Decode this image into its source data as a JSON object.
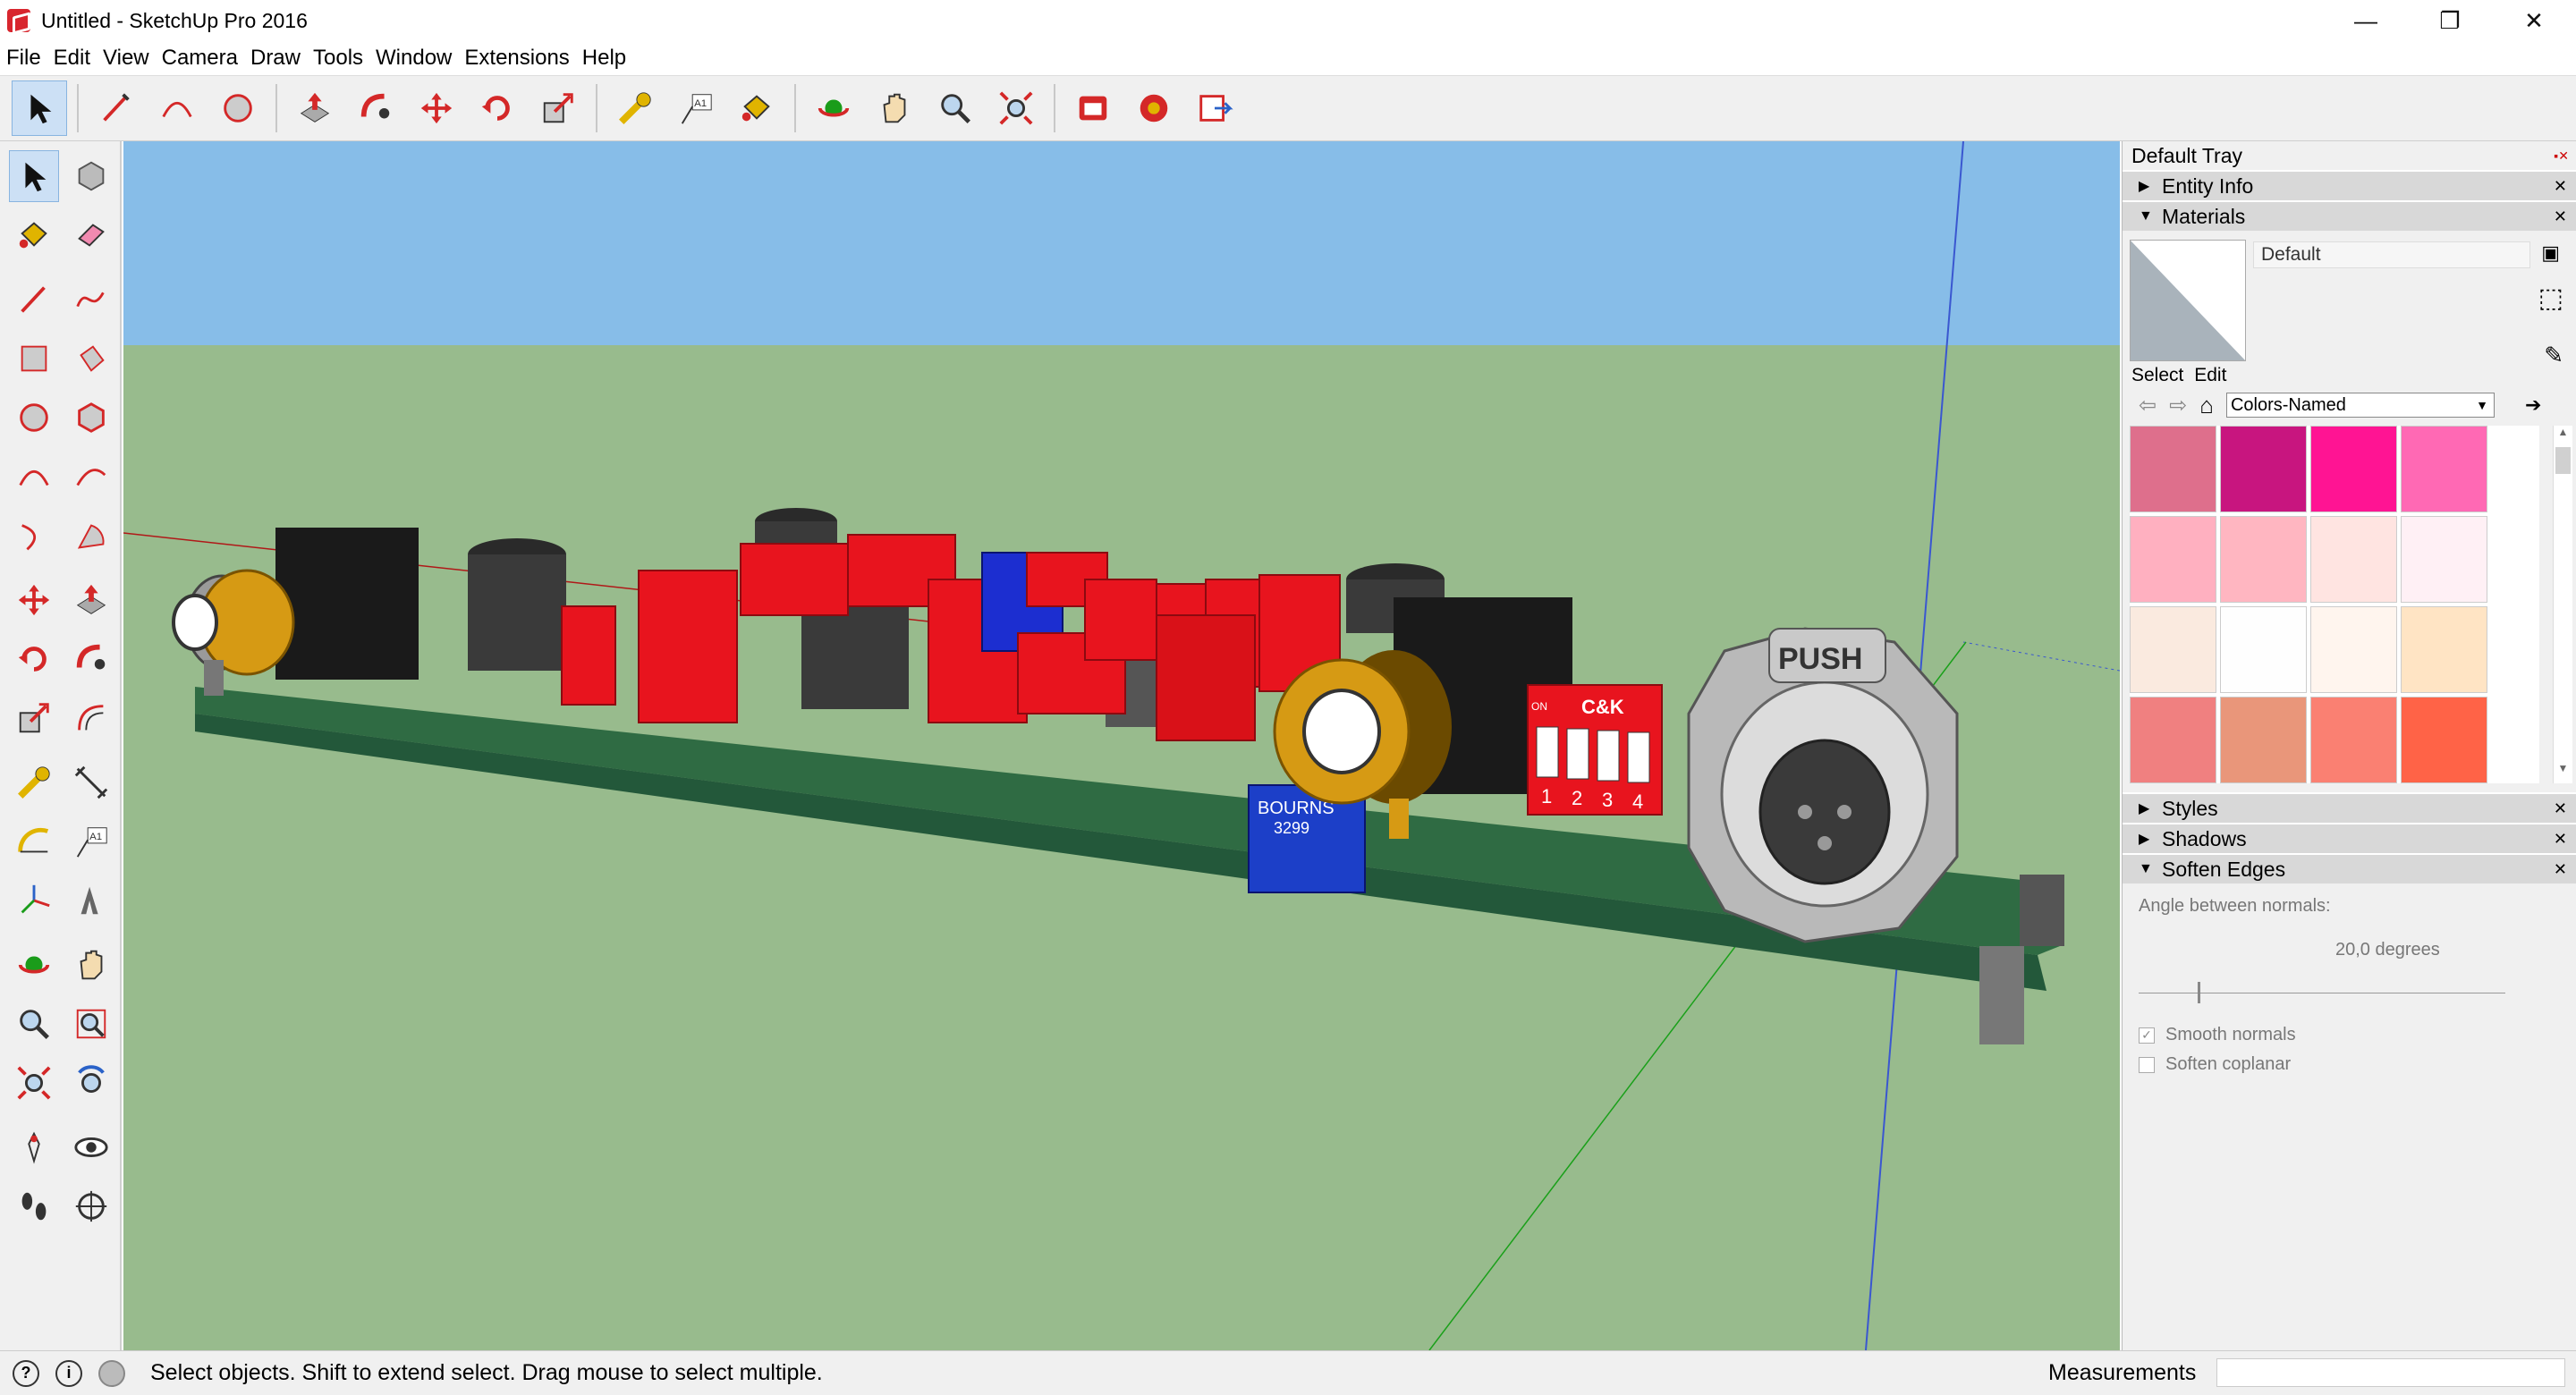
{
  "window": {
    "title": "Untitled - SketchUp Pro 2016",
    "minimize_glyph": "—",
    "restore_glyph": "❐",
    "close_glyph": "✕"
  },
  "menu": [
    "File",
    "Edit",
    "View",
    "Camera",
    "Draw",
    "Tools",
    "Window",
    "Extensions",
    "Help"
  ],
  "toolbar": {
    "groups": [
      [
        "select-icon"
      ],
      [
        "pencil-icon",
        "arc-icon",
        "circle-icon"
      ],
      [
        "push-pull-icon",
        "follow-me-icon",
        "move-icon",
        "rotate-icon",
        "scale-icon"
      ],
      [
        "tape-measure-icon",
        "text-icon",
        "paint-bucket-icon"
      ],
      [
        "orbit-icon",
        "pan-icon",
        "zoom-icon",
        "zoom-extents-icon"
      ],
      [
        "warehouse-icon",
        "extension-warehouse-icon",
        "layout-icon"
      ]
    ]
  },
  "left_tools": [
    [
      "select-icon",
      "component-icon"
    ],
    [
      "paint-bucket-icon",
      "eraser-icon"
    ],
    [
      "line-icon",
      "freehand-icon"
    ],
    [
      "rectangle-icon",
      "rotated-rectangle-icon"
    ],
    [
      "circle-icon",
      "polygon-icon"
    ],
    [
      "arc-icon",
      "2pt-arc-icon"
    ],
    [
      "3pt-arc-icon",
      "pie-icon"
    ],
    [
      "move-icon",
      "push-pull-icon"
    ],
    [
      "rotate-icon",
      "follow-me-icon"
    ],
    [
      "scale-icon",
      "offset-icon"
    ],
    [
      "tape-measure-icon",
      "dimension-icon"
    ],
    [
      "protractor-icon",
      "text-icon"
    ],
    [
      "axes-icon",
      "3d-text-icon"
    ],
    [
      "orbit-icon",
      "pan-icon"
    ],
    [
      "zoom-icon",
      "zoom-window-icon"
    ],
    [
      "zoom-extents-icon",
      "previous-view-icon"
    ],
    [
      "position-camera-icon",
      "look-around-icon"
    ],
    [
      "walk-icon",
      "section-plane-icon"
    ]
  ],
  "model": {
    "bourns_label": "BOURNS",
    "bourns_part": "3299",
    "ck_label": "C&K",
    "dip_on": "ON",
    "dip_numbers": [
      "1",
      "2",
      "3",
      "4"
    ],
    "push_label": "PUSH",
    "sky_color": "#87bde8",
    "ground_color": "#98bb8d",
    "pcb_color": "#2f6b43",
    "component_red": "#e8141e"
  },
  "tray": {
    "title": "Default Tray",
    "panels_top": [
      {
        "label": "Entity Info",
        "expanded": false
      },
      {
        "label": "Materials",
        "expanded": true
      }
    ],
    "materials": {
      "name": "Default",
      "tab_select": "Select",
      "tab_edit": "Edit",
      "library": "Colors-Named",
      "swatches": [
        "#de6f8c",
        "#c8157f",
        "#ff1493",
        "#ff69b4",
        "#ffb0c0",
        "#ffb6c1",
        "#ffe4e1",
        "#fff0f5",
        "#faeadf",
        "#fefefe",
        "#fff5ee",
        "#ffe4c4",
        "#f08080",
        "#e9967a",
        "#fa8072",
        "#ff6347"
      ]
    },
    "panels_bottom": [
      {
        "label": "Styles",
        "expanded": false
      },
      {
        "label": "Shadows",
        "expanded": false
      },
      {
        "label": "Soften Edges",
        "expanded": true
      }
    ],
    "soften": {
      "angle_label": "Angle between normals:",
      "angle_value": "20,0  degrees",
      "angle_fraction": 0.16,
      "smooth_normals": "Smooth normals",
      "smooth_checked": true,
      "soften_coplanar": "Soften coplanar",
      "coplanar_checked": false
    }
  },
  "status": {
    "message": "Select objects. Shift to extend select. Drag mouse to select multiple.",
    "measurements_label": "Measurements",
    "measurements_value": ""
  }
}
